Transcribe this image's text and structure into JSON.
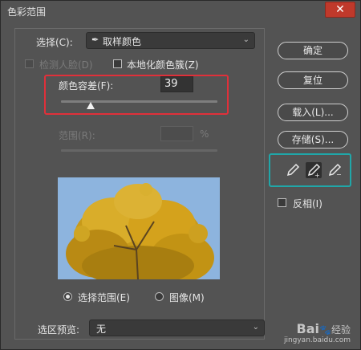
{
  "window": {
    "title": "色彩范围",
    "close_label": "✕"
  },
  "select": {
    "label": "选择(C):",
    "value": "取样颜色"
  },
  "checks": {
    "detect_faces": "检测人脸(D)",
    "localized": "本地化颜色簇(Z)"
  },
  "fuzziness": {
    "label": "颜色容差(F):",
    "value": "39",
    "fraction": 0.19
  },
  "range": {
    "label": "范围(R):",
    "value": "",
    "unit": "%"
  },
  "view": {
    "selection": "选择范围(E)",
    "image": "图像(M)"
  },
  "preview_mode": {
    "label": "选区预览:",
    "value": "无"
  },
  "buttons": {
    "ok": "确定",
    "reset": "复位",
    "load": "载入(L)...",
    "save": "存储(S)..."
  },
  "invert": {
    "label": "反相(I)"
  },
  "watermark": {
    "line1": "Bai",
    "line2": "经验",
    "url": "jingyan.baidu.com"
  },
  "colors": {
    "red_highlight": "#e0303a",
    "teal_highlight": "#20a7a9",
    "sky": "#8db4de",
    "foliage": "#d4a21c"
  }
}
